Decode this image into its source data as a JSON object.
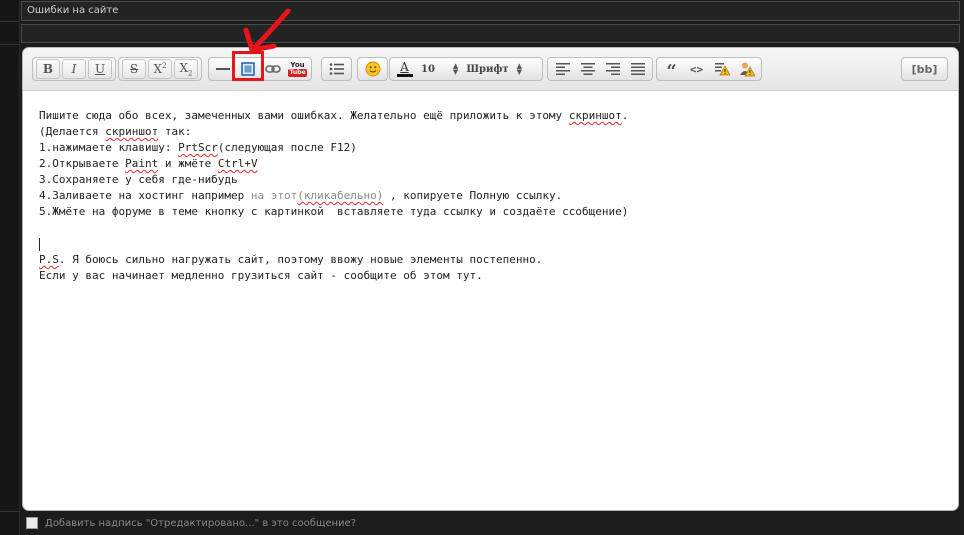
{
  "subject": {
    "value": "Ошибки на сайте"
  },
  "toolbar": {
    "bold": "B",
    "italic": "I",
    "underline": "U",
    "strike": "S",
    "superscript": "X",
    "sup_mark": "2",
    "subscript": "X",
    "sub_mark": "2",
    "youtube_top": "You",
    "youtube_bottom": "Tube",
    "font_color_label": "A",
    "font_size": "10",
    "font_name": "Шрифт",
    "bbcode": "[bb]"
  },
  "icons": [
    "bold",
    "italic",
    "underline",
    "strike-icon",
    "superscript-icon",
    "subscript-icon",
    "horizontal-rule-icon",
    "image-icon",
    "link-icon",
    "youtube-icon",
    "list-icon",
    "smiley-icon",
    "font-color-icon",
    "align-left-icon",
    "align-center-icon",
    "align-right-icon",
    "align-justify-icon",
    "quote-icon",
    "code-icon",
    "spoiler-icon",
    "hide-icon"
  ],
  "editor": {
    "line1": "Пишите сюда обо всех, замеченных вами ошибках. Желательно ещё приложить к этому ",
    "line1_word": "скриншот",
    "line1_end": ".",
    "line2_a": "(Делается ",
    "line2_word": "скриншот",
    "line2_b": " так:",
    "line3_a": "1.нажимаете клавишу: ",
    "line3_word": "PrtScr",
    "line3_b": "(следующая после F12)",
    "line4_a": "2.Открываете ",
    "line4_word1": "Paint",
    "line4_b": " и жмёте ",
    "line4_word2": "Ctrl+V",
    "line5": "3.Сохраняете у себя где-нибудь",
    "line6_a": "4.Заливаете на хостинг например ",
    "line6_link": "на этот",
    "line6_paren": "(кликабельно)",
    "line6_b": " , копируете Полную ссылку.",
    "line7": "5.Жмёте на форуме в теме кнопку с картинкой  вставляете туда ссылку и создаёте ссобщение)",
    "ps_word": "P.S",
    "ps_rest": ". Я боюсь сильно нагружать сайт, поэтому ввожу новые элементы постепенно.",
    "last_line": "Если у вас начинает медленно грузиться сайт - сообщите об этом тут."
  },
  "footer": {
    "checkbox_label": "Добавить надпись \"Отредактировано...\" в это сообщение?"
  },
  "colors": {
    "highlight": "#e8141b",
    "background": "#1c1c1c",
    "link": "#8a8a8a"
  }
}
